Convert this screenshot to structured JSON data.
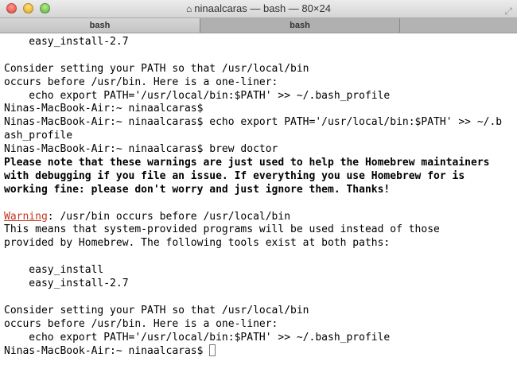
{
  "window": {
    "title": "ninaalcaras — bash — 80×24",
    "icon": "home-icon"
  },
  "tabs": [
    {
      "label": "bash",
      "active": true
    },
    {
      "label": "bash",
      "active": false
    }
  ],
  "colors": {
    "warning": "#c23621"
  },
  "terminal": {
    "lines": [
      {
        "text": "    easy_install-2.7"
      },
      {
        "text": ""
      },
      {
        "text": "Consider setting your PATH so that /usr/local/bin"
      },
      {
        "text": "occurs before /usr/bin. Here is a one-liner:"
      },
      {
        "text": "    echo export PATH='/usr/local/bin:$PATH' >> ~/.bash_profile"
      },
      {
        "text": "Ninas-MacBook-Air:~ ninaalcaras$"
      },
      {
        "text": "Ninas-MacBook-Air:~ ninaalcaras$ echo export PATH='/usr/local/bin:$PATH' >> ~/.b"
      },
      {
        "text": "ash_profile"
      },
      {
        "text": "Ninas-MacBook-Air:~ ninaalcaras$ brew doctor"
      },
      {
        "text": "Please note that these warnings are just used to help the Homebrew maintainers",
        "bold": true
      },
      {
        "text": "with debugging if you file an issue. If everything you use Homebrew for is",
        "bold": true
      },
      {
        "text": "working fine: please don't worry and just ignore them. Thanks!",
        "bold": true
      },
      {
        "text": ""
      },
      {
        "warning": "Warning",
        "text": ": /usr/bin occurs before /usr/local/bin"
      },
      {
        "text": "This means that system-provided programs will be used instead of those"
      },
      {
        "text": "provided by Homebrew. The following tools exist at both paths:"
      },
      {
        "text": ""
      },
      {
        "text": "    easy_install"
      },
      {
        "text": "    easy_install-2.7"
      },
      {
        "text": ""
      },
      {
        "text": "Consider setting your PATH so that /usr/local/bin"
      },
      {
        "text": "occurs before /usr/bin. Here is a one-liner:"
      },
      {
        "text": "    echo export PATH='/usr/local/bin:$PATH' >> ~/.bash_profile"
      },
      {
        "text": "Ninas-MacBook-Air:~ ninaalcaras$ ",
        "cursor": true
      }
    ]
  }
}
